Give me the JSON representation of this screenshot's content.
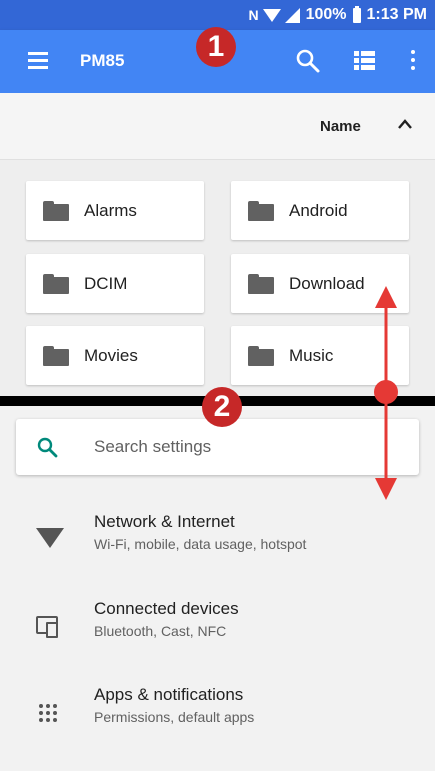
{
  "status_bar": {
    "nfc": "N",
    "battery": "100%",
    "time": "1:13 PM"
  },
  "toolbar": {
    "title": "PM85",
    "search_icon": "search-icon",
    "view_icon": "list-view-icon",
    "more_icon": "more-vert-icon",
    "color": "#4285f4"
  },
  "annotations": {
    "badge_1": "1",
    "badge_2": "2",
    "color": "#c62828"
  },
  "sort": {
    "label": "Name",
    "chevron_icon": "chevron-up-icon"
  },
  "folders": [
    {
      "name": "Alarms"
    },
    {
      "name": "Android"
    },
    {
      "name": "DCIM"
    },
    {
      "name": "Download"
    },
    {
      "name": "Movies"
    },
    {
      "name": "Music"
    }
  ],
  "settings": {
    "search_placeholder": "Search settings",
    "accent": "#00897b",
    "items": [
      {
        "title": "Network & Internet",
        "subtitle": "Wi-Fi, mobile, data usage, hotspot",
        "icon": "wifi-icon"
      },
      {
        "title": "Connected devices",
        "subtitle": "Bluetooth, Cast, NFC",
        "icon": "devices-icon"
      },
      {
        "title": "Apps & notifications",
        "subtitle": "Permissions, default apps",
        "icon": "apps-icon"
      }
    ]
  }
}
